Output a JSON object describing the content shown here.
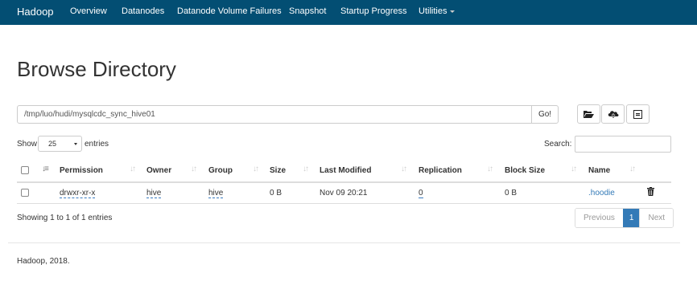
{
  "navbar": {
    "brand": "Hadoop",
    "items": [
      "Overview",
      "Datanodes",
      "Datanode Volume Failures",
      "Snapshot",
      "Startup Progress",
      "Utilities"
    ]
  },
  "page_title": "Browse Directory",
  "path": {
    "value": "/tmp/luo/hudi/mysqlcdc_sync_hive01",
    "go_label": "Go!"
  },
  "toolbar": {
    "icons": [
      "folder-open-icon",
      "cloud-upload-icon",
      "cut-icon"
    ]
  },
  "length": {
    "show_label": "Show",
    "selected": "25",
    "entries_label": "entries"
  },
  "search": {
    "label": "Search:",
    "value": ""
  },
  "table": {
    "columns": [
      "Permission",
      "Owner",
      "Group",
      "Size",
      "Last Modified",
      "Replication",
      "Block Size",
      "Name"
    ],
    "rows": [
      {
        "permission": "drwxr-xr-x",
        "owner": "hive",
        "group": "hive",
        "size": "0 B",
        "last_modified": "Nov 09 20:21",
        "replication": "0",
        "block_size": "0 B",
        "name": ".hoodie"
      }
    ]
  },
  "pagination": {
    "info": "Showing 1 to 1 of 1 entries",
    "previous": "Previous",
    "current": "1",
    "next": "Next"
  },
  "footer": "Hadoop, 2018.",
  "colors": {
    "navbar_bg": "#034e73",
    "link": "#337ab7",
    "active_page": "#337ab7"
  }
}
